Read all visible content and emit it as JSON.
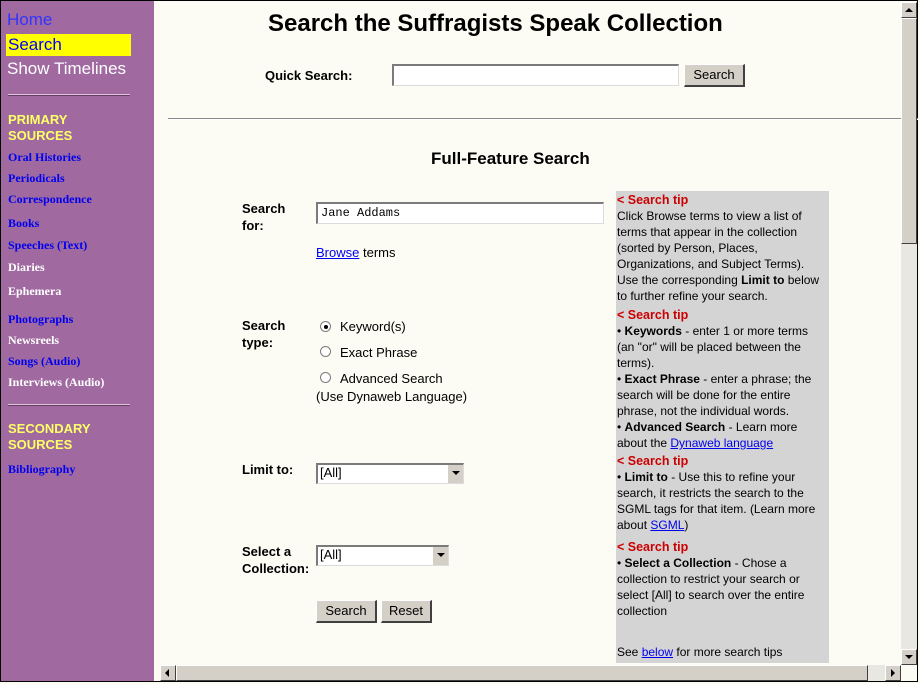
{
  "sidebar": {
    "home": "Home",
    "search": "Search",
    "timelines": "Show Timelines",
    "primary_heading": "PRIMARY SOURCES",
    "primary_items": [
      "Oral Histories",
      "Periodicals",
      "Correspondence",
      "Books",
      "Speeches (Text)",
      "Diaries",
      "Ephemera",
      "Photographs",
      "Newsreels",
      "Songs (Audio)",
      "Interviews (Audio)"
    ],
    "secondary_heading": "SECONDARY SOURCES",
    "secondary_items": [
      "Bibliography"
    ]
  },
  "header": {
    "title": "Search the Suffragists Speak Collection",
    "quick_search_label": "Quick Search:",
    "quick_search_value": "",
    "quick_search_button": "Search"
  },
  "form": {
    "title": "Full-Feature Search",
    "search_for_label": "Search for:",
    "search_for_value": "Jane Addams",
    "browse_link": "Browse",
    "browse_suffix": " terms",
    "search_type_label": "Search type:",
    "search_types": [
      "Keyword(s)",
      "Exact Phrase",
      "Advanced Search"
    ],
    "search_type_selected": "Keyword(s)",
    "dynaweb_note": "(Use Dynaweb Language)",
    "limit_label": "Limit to:",
    "limit_value": "[All]",
    "collection_label": "Select a Collection:",
    "collection_value": "[All]",
    "search_button": "Search",
    "reset_button": "Reset"
  },
  "tips": {
    "head": "< Search tip",
    "tip1_text": "Click Browse terms to view a list of terms that appear in the collection (sorted by Person, Places, Organizations, and Subject Terms). Use the corresponding ",
    "tip1_bold": "Limit to",
    "tip1_end": " below to further refine your search.",
    "tip2_kw_b": "Keywords",
    "tip2_kw": " - enter 1 or more terms (an \"or\" will be placed between the terms).",
    "tip2_ex_b": "Exact Phrase",
    "tip2_ex": " - enter a phrase; the search will be done for the entire phrase, not the individual words.",
    "tip2_adv_b": "Advanced Search",
    "tip2_adv": " - Learn more about the ",
    "tip2_link": "Dynaweb language ",
    "tip3_b": "Limit to",
    "tip3": " - Use this to refine your search, it restricts the search to the SGML tags for that item. (Learn more about ",
    "tip3_link": "SGML",
    "tip3_end": ")",
    "tip4_b": "Select a Collection",
    "tip4": " - Chose a collection to restrict your search or select [All] to search over the entire collection",
    "see": "See ",
    "see_link": "below",
    "see_end": " for more search tips"
  }
}
